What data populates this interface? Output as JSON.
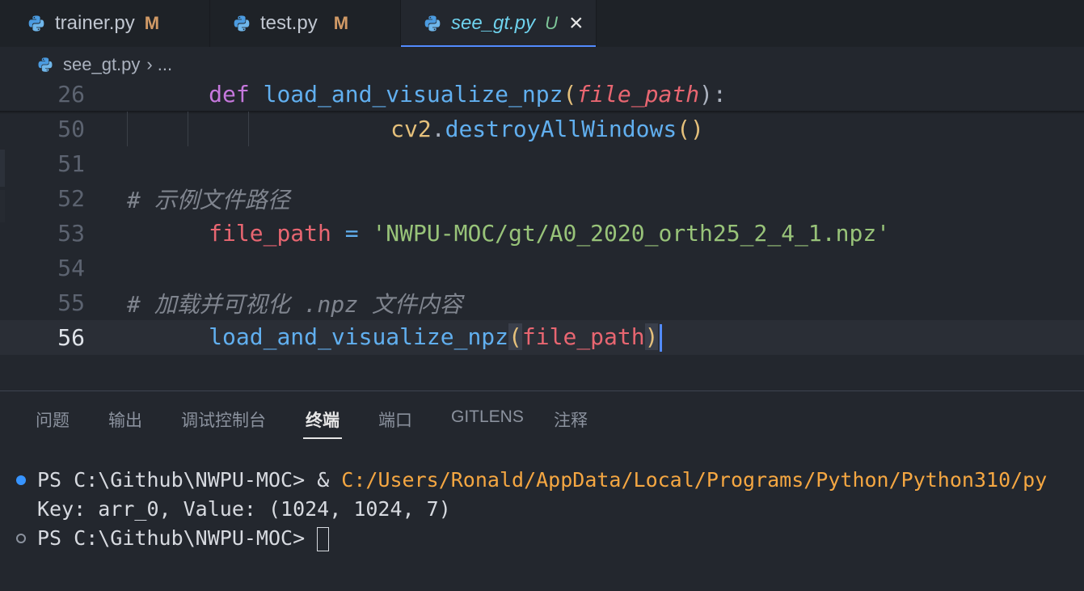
{
  "tabs": [
    {
      "name": "trainer.py",
      "badge": "M"
    },
    {
      "name": "test.py",
      "badge": "M"
    },
    {
      "name": "see_gt.py",
      "badge": "U",
      "close": "×"
    }
  ],
  "breadcrumb": {
    "file": "see_gt.py",
    "sep": "›",
    "more": "..."
  },
  "editor": {
    "lines": [
      {
        "num": "26",
        "def": "def",
        "name": "load_and_visualize_npz",
        "open": "(",
        "param": "file_path",
        "close": "):"
      },
      {
        "num": "50",
        "obj": "cv2",
        "dot": ".",
        "call": "destroyAllWindows",
        "parens": "()"
      },
      {
        "num": "51"
      },
      {
        "num": "52",
        "comment": "# 示例文件路径"
      },
      {
        "num": "53",
        "var": "file_path",
        "eq": " = ",
        "string": "'NWPU-MOC/gt/A0_2020_orth25_2_4_1.npz'"
      },
      {
        "num": "54"
      },
      {
        "num": "55",
        "comment": "# 加载并可视化 .npz 文件内容"
      },
      {
        "num": "56",
        "call": "load_and_visualize_npz",
        "open": "(",
        "arg": "file_path",
        "close": ")"
      }
    ]
  },
  "panel": {
    "tabs": [
      "问题",
      "输出",
      "调试控制台",
      "终端",
      "端口",
      "GITLENS",
      "注释"
    ],
    "active_tab": "终端"
  },
  "terminal": {
    "prompt": "PS C:\\Github\\NWPU-MOC> ",
    "amp": "& ",
    "command": "C:/Users/Ronald/AppData/Local/Programs/Python/Python310/py",
    "output": "Key: arr_0, Value: (1024, 1024, 7)",
    "prompt2": "PS C:\\Github\\NWPU-MOC> "
  },
  "colors": {
    "accent": "#528bff",
    "modified": "#d19a66",
    "untracked": "#7ec699"
  }
}
